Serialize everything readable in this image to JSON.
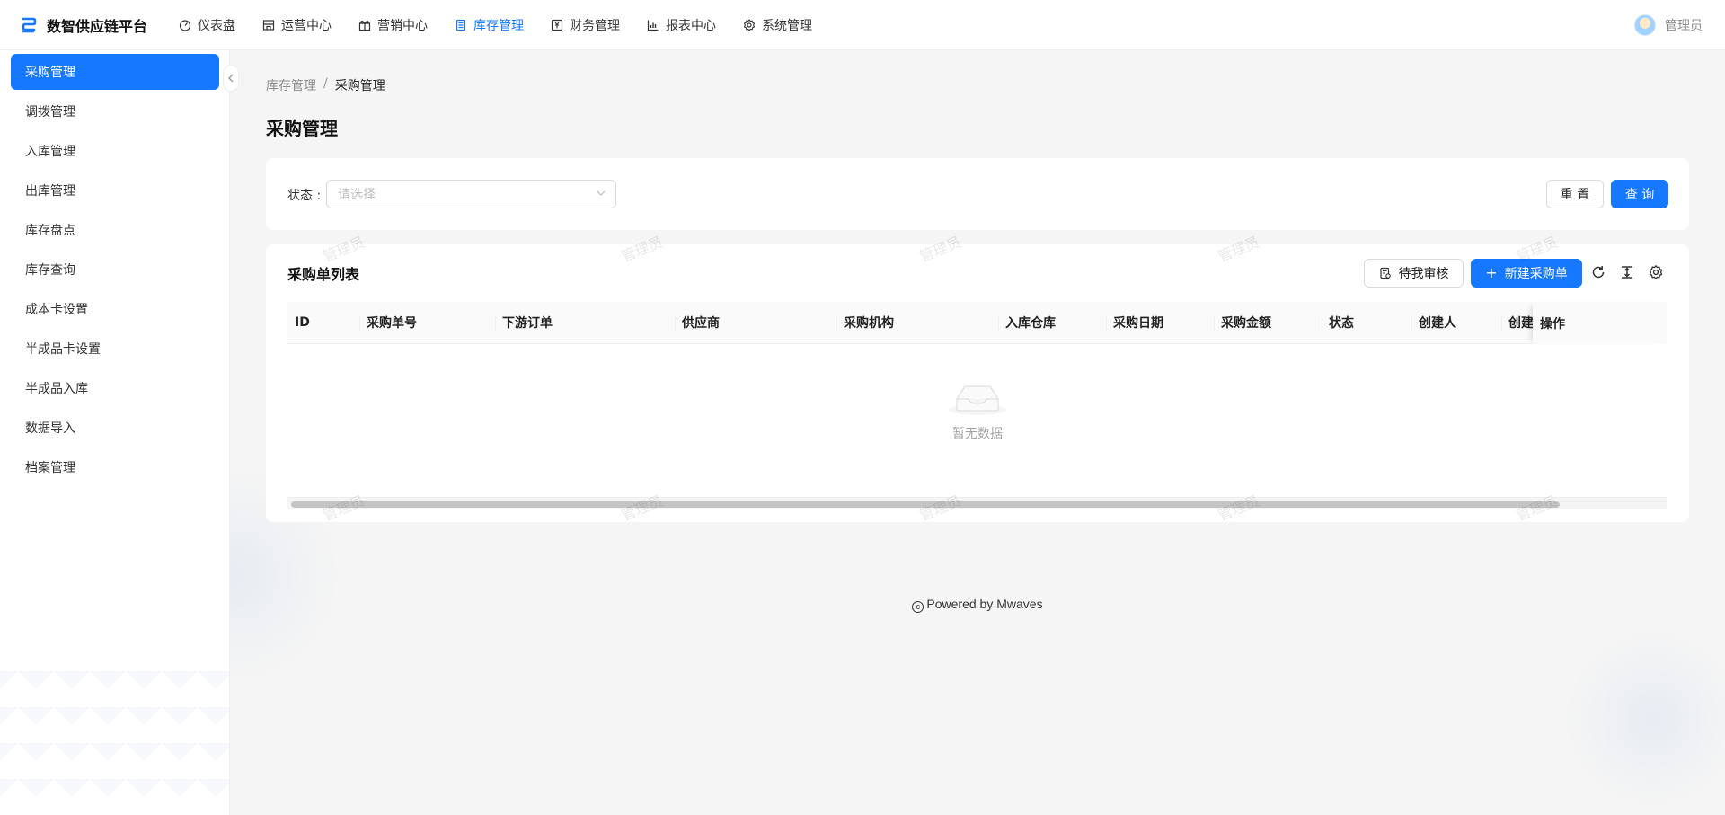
{
  "app": {
    "title": "数智供应链平台",
    "accent": "#1677ff"
  },
  "nav": {
    "items": [
      {
        "label": "仪表盘",
        "icon": "dashboard-icon"
      },
      {
        "label": "运营中心",
        "icon": "store-icon"
      },
      {
        "label": "营销中心",
        "icon": "gift-icon"
      },
      {
        "label": "库存管理",
        "icon": "inventory-icon",
        "active": true
      },
      {
        "label": "财务管理",
        "icon": "finance-icon"
      },
      {
        "label": "报表中心",
        "icon": "chart-icon"
      },
      {
        "label": "系统管理",
        "icon": "gear-icon"
      }
    ],
    "user": "管理员"
  },
  "sidebar": {
    "items": [
      {
        "label": "采购管理",
        "active": true
      },
      {
        "label": "调拨管理"
      },
      {
        "label": "入库管理"
      },
      {
        "label": "出库管理"
      },
      {
        "label": "库存盘点"
      },
      {
        "label": "库存查询"
      },
      {
        "label": "成本卡设置"
      },
      {
        "label": "半成品卡设置"
      },
      {
        "label": "半成品入库"
      },
      {
        "label": "数据导入"
      },
      {
        "label": "档案管理"
      }
    ]
  },
  "breadcrumb": {
    "parent": "库存管理",
    "separator": "/",
    "current": "采购管理"
  },
  "page": {
    "title": "采购管理"
  },
  "filter": {
    "status_label": "状态 :",
    "status_placeholder": "请选择",
    "reset_label": "重 置",
    "query_label": "查 询"
  },
  "list": {
    "title": "采购单列表",
    "pending_label": "待我审核",
    "new_label": "新建采购单",
    "columns": [
      "ID",
      "采购单号",
      "下游订单",
      "供应商",
      "采购机构",
      "入库仓库",
      "采购日期",
      "采购金额",
      "状态",
      "创建人",
      "创建"
    ],
    "operation_column": "操作",
    "empty_text": "暂无数据"
  },
  "watermark": {
    "text": "管理员"
  },
  "footer": {
    "text": "Powered by Mwaves"
  }
}
